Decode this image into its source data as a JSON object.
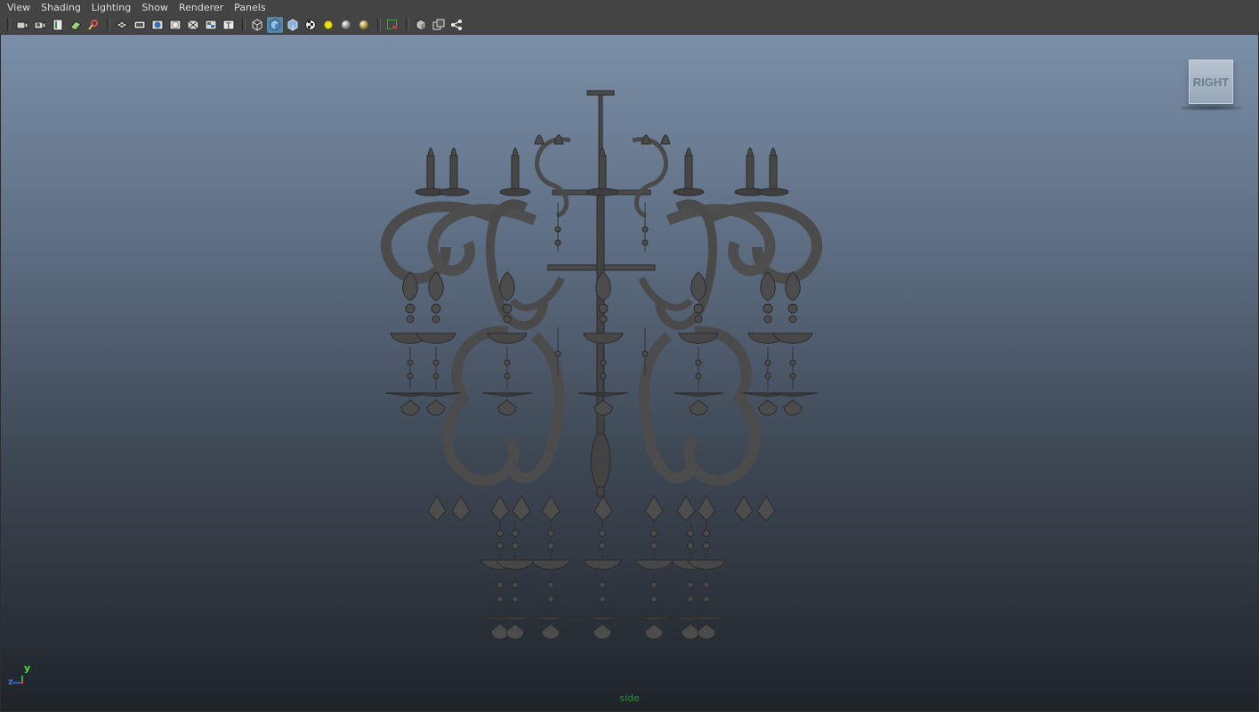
{
  "menu": [
    "View",
    "Shading",
    "Lighting",
    "Show",
    "Renderer",
    "Panels"
  ],
  "toolbar_icons": [
    "select-camera-icon",
    "camera-attributes-icon",
    "bookmarks-icon",
    "image-plane-icon",
    "2d-pan-zoom-icon",
    "grid-icon",
    "film-gate-icon",
    "resolution-gate-icon",
    "gate-mask-icon",
    "field-chart-icon",
    "safe-action-icon",
    "safe-title-icon",
    "wireframe-icon",
    "smooth-shade-icon",
    "shade-with-wire-icon",
    "textured-icon",
    "use-all-lights-icon",
    "shadows-icon",
    "ambient-occlusion-icon",
    "isolate-select-icon",
    "xray-icon",
    "xray-joints-icon",
    "xray-components-icon"
  ],
  "viewcube": {
    "label": "RIGHT"
  },
  "axis": {
    "y": "y",
    "z": "z"
  },
  "camera_label": "side",
  "colors": {
    "ui_bg": "#444444",
    "viewport_top": "#7b8fa8",
    "viewport_bottom": "#1f2429",
    "model": "#4a4a4a",
    "camera_label": "#2f8a3a"
  }
}
